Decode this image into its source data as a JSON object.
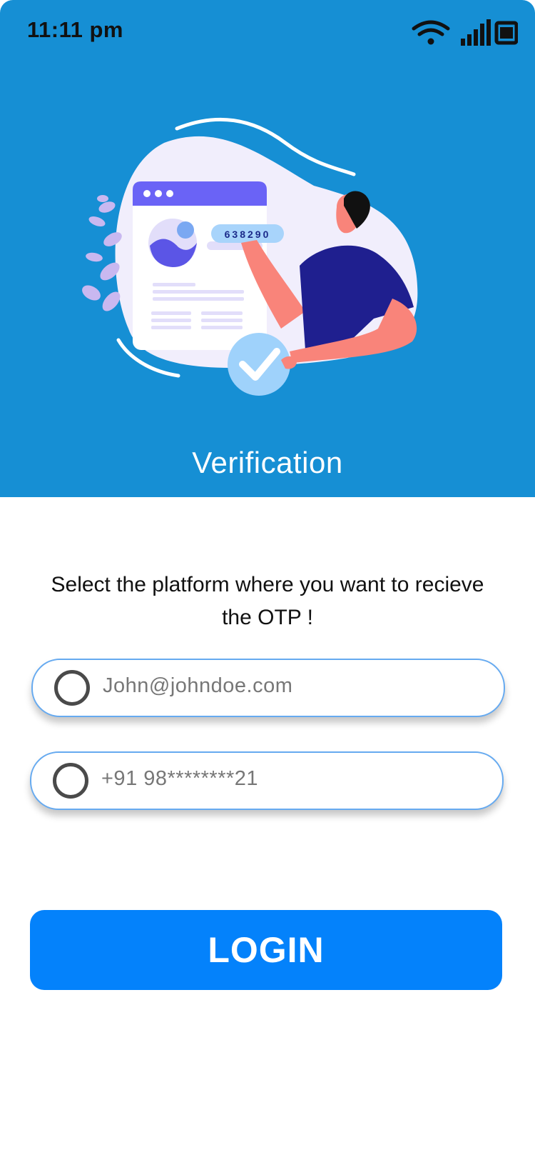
{
  "status_bar": {
    "time": "11:11 pm",
    "icons": [
      "wifi-icon",
      "signal-icon",
      "battery-icon"
    ]
  },
  "header": {
    "illustration_code": "638290",
    "title": "Verification"
  },
  "prompt": "Select the platform where you want to recieve the OTP !",
  "options": [
    {
      "label": "John@johndoe.com",
      "selected": false
    },
    {
      "label": "+91 98********21",
      "selected": false
    }
  ],
  "login_label": "LOGIN",
  "colors": {
    "header_bg": "#168fd4",
    "button_bg": "#0482fb",
    "option_border": "#66aaf0"
  }
}
